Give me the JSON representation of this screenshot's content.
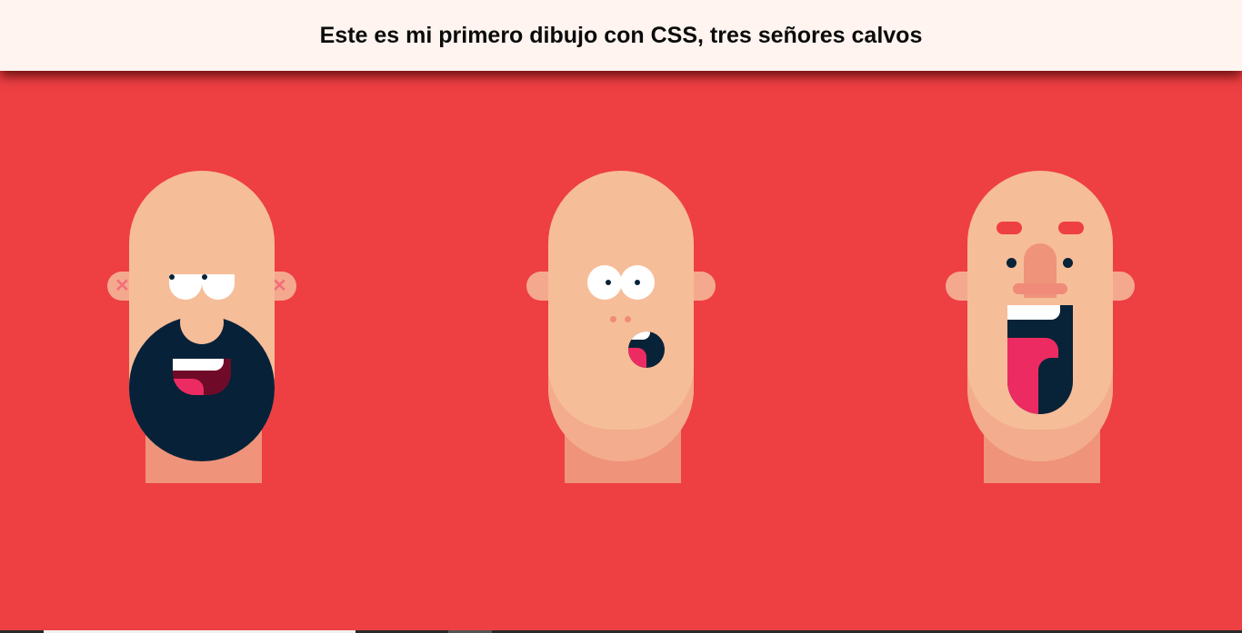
{
  "header": {
    "title": "Este es mi primero dibujo con CSS, tres señores calvos"
  },
  "colors": {
    "background": "#ee3f43",
    "header_background": "#fff4ef",
    "skin": "#f6bd99",
    "skin_shadow": "#f3ac8d",
    "neck": "#ef937a",
    "beard": "#072138",
    "tongue": "#ec2b62"
  },
  "faces": [
    {
      "name": "bearded-man",
      "ear_marks": [
        "✕",
        "✕"
      ]
    },
    {
      "name": "surprised-man"
    },
    {
      "name": "shouting-man"
    }
  ],
  "scroll_indicator": {
    "icon": "horizontal-scrollbar"
  }
}
